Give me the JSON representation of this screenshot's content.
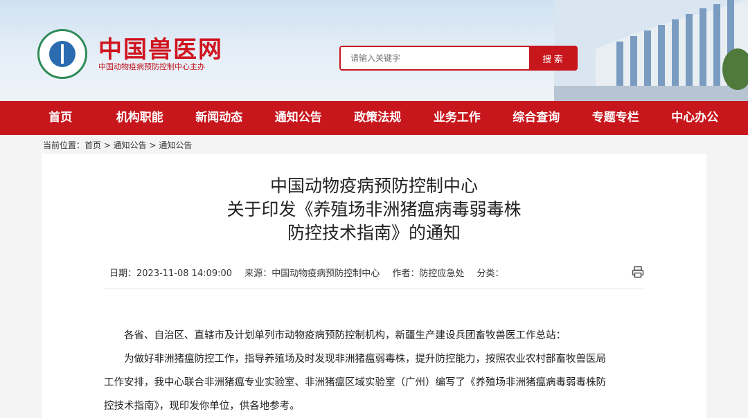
{
  "header": {
    "site_name": "中国兽医网",
    "site_subtitle": "中国动物疫病预防控制中心主办",
    "emblem_icon": "emblem-icon",
    "search_placeholder": "请输入关键字",
    "search_button": "搜 索",
    "accent_color": "#c8161d"
  },
  "nav": {
    "items": [
      {
        "label": "首页"
      },
      {
        "label": "机构职能"
      },
      {
        "label": "新闻动态"
      },
      {
        "label": "通知公告"
      },
      {
        "label": "政策法规"
      },
      {
        "label": "业务工作"
      },
      {
        "label": "综合查询"
      },
      {
        "label": "专题专栏"
      },
      {
        "label": "中心办公"
      }
    ]
  },
  "breadcrumb": "当前位置：首页 > 通知公告 > 通知公告",
  "article": {
    "title_line1": "中国动物疫病预防控制中心",
    "title_line2": "关于印发《养殖场非洲猪瘟病毒弱毒株",
    "title_line3": "防控技术指南》的通知",
    "date": "日期：2023-11-08 14:09:00",
    "source": "来源：中国动物疫病预防控制中心",
    "author": "作者：防控应急处",
    "category": "分类：",
    "print_icon": "print-icon",
    "paragraph1": "各省、自治区、直辖市及计划单列市动物疫病预防控制机构，新疆生产建设兵团畜牧兽医工作总站：",
    "paragraph2_l1": "为做好非洲猪瘟防控工作，指导养殖场及时发现非洲猪瘟弱毒株，提升防控能力，按照农业农村部畜牧兽医局",
    "paragraph2_l2": "工作安排，我中心联合非洲猪瘟专业实验室、非洲猪瘟区域实验室（广州）编写了《养殖场非洲猪瘟病毒弱毒株防",
    "paragraph2_l3": "控技术指南》，现印发你单位，供各地参考。"
  }
}
